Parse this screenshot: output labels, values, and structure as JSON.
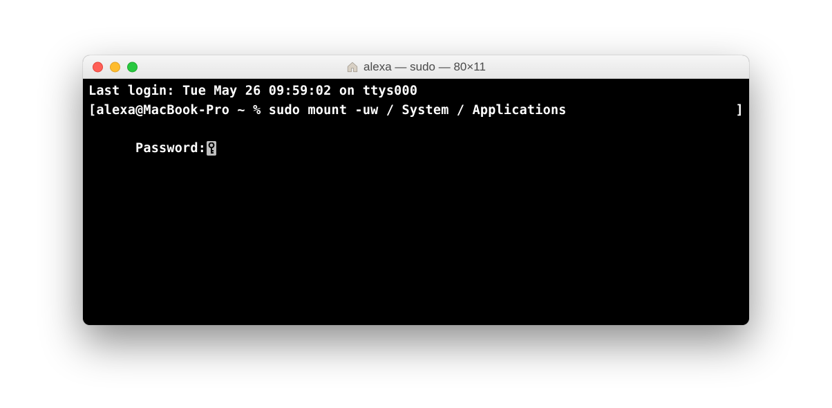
{
  "titlebar": {
    "title": "alexa — sudo — 80×11"
  },
  "terminal": {
    "line1": "Last login: Tue May 26 09:59:02 on ttys000",
    "line2_open": "[",
    "line2_text": "alexa@MacBook-Pro ~ % sudo mount -uw / System / Applications",
    "line2_close": "]",
    "line3": "Password:"
  }
}
